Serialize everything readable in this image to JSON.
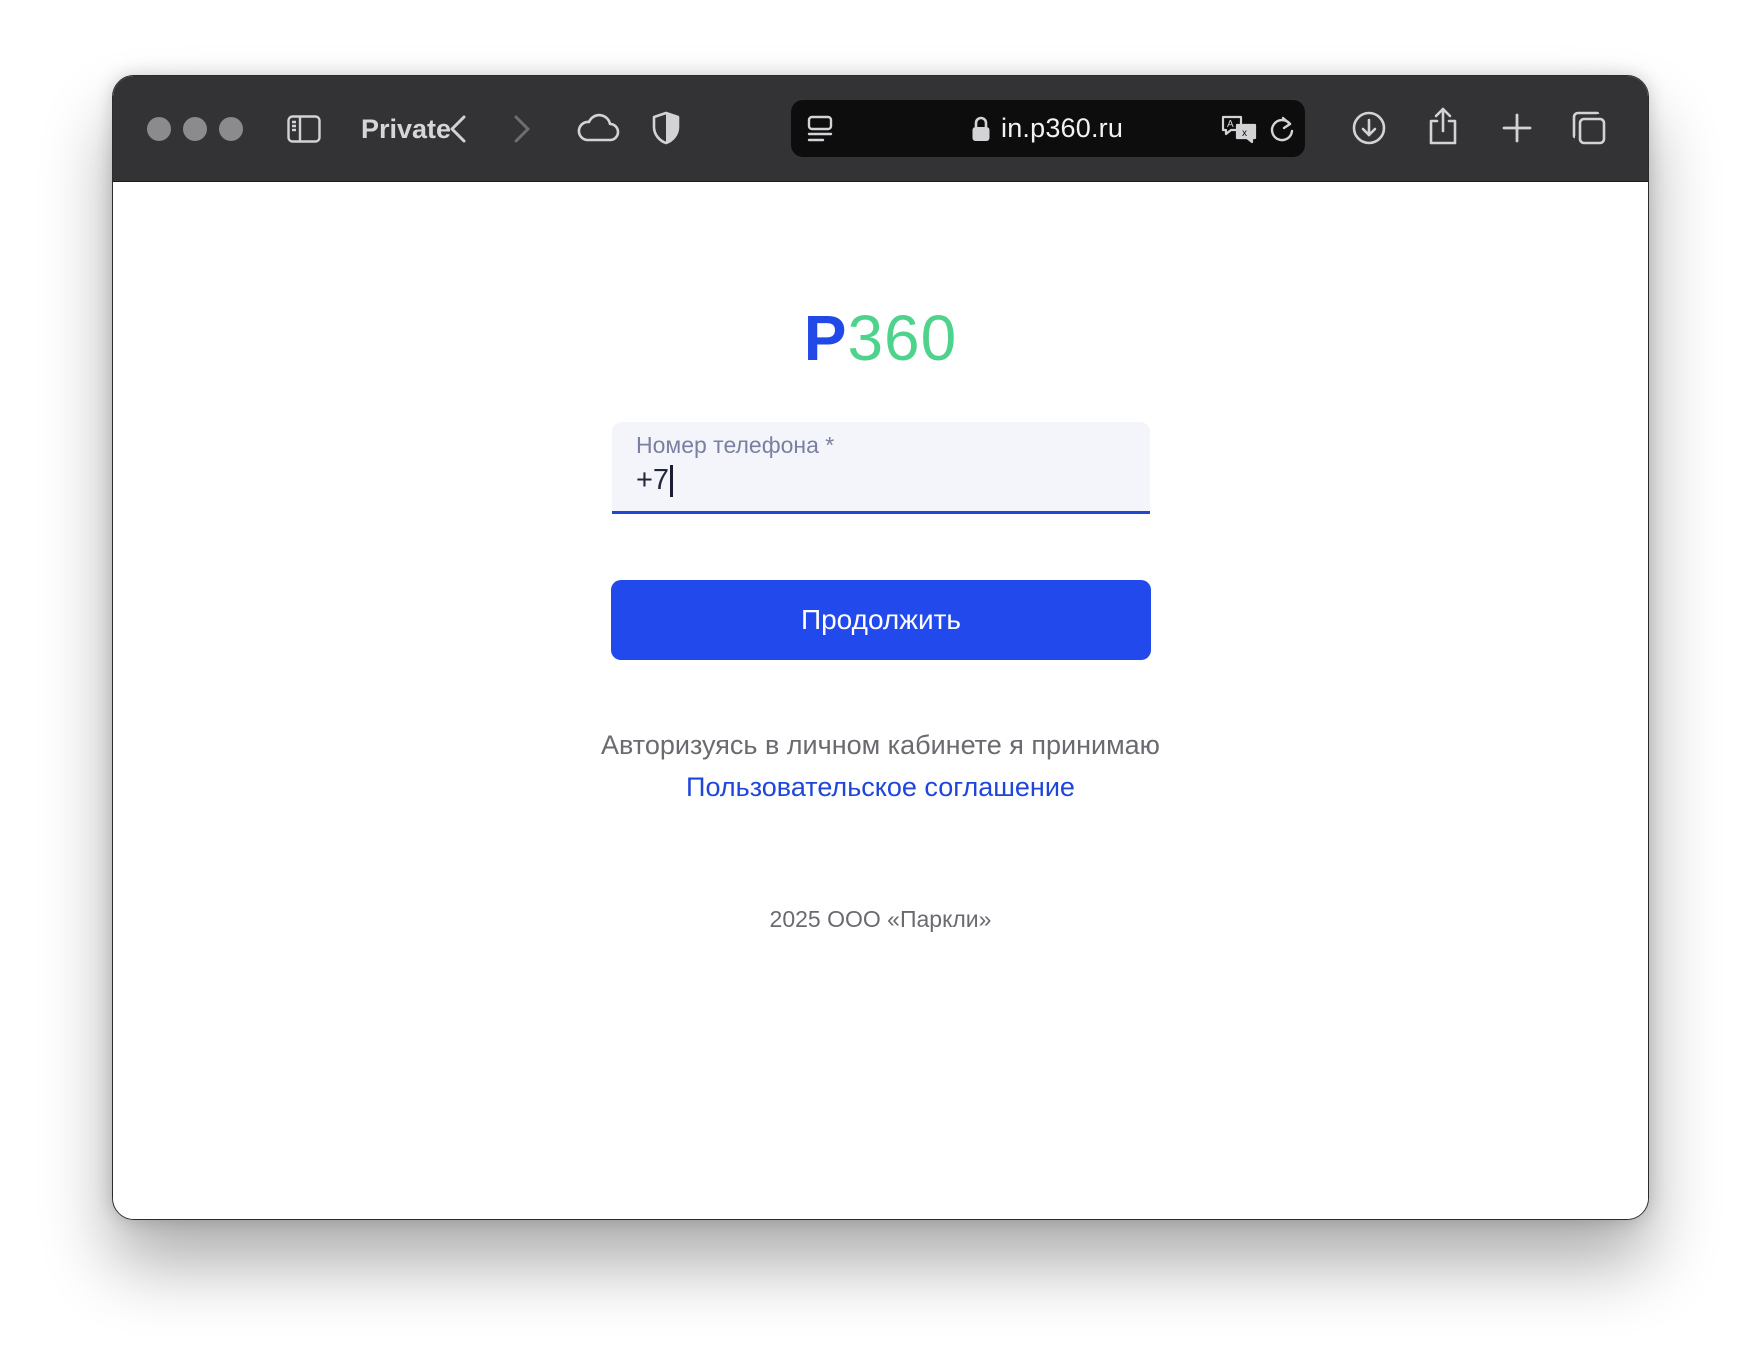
{
  "browser": {
    "mode_label": "Private",
    "url": "in.p360.ru",
    "colors": {
      "toolbar": "#333335",
      "address_bar": "#0d0d0e"
    },
    "icons": [
      "close-light",
      "minimize-light",
      "zoom-light",
      "sidebar-icon",
      "back-arrow-icon",
      "forward-arrow-icon",
      "cloud-icon",
      "shield-icon",
      "reader-icon",
      "lock-icon",
      "translate-icon",
      "reload-icon",
      "download-icon",
      "share-icon",
      "new-tab-icon",
      "tabs-overview-icon"
    ]
  },
  "page": {
    "logo": {
      "letter": "P",
      "number": "360",
      "colors": {
        "letter": "#2149e8",
        "number": "#4ed38d"
      }
    },
    "phone_field": {
      "label": "Номер телефона *",
      "value": "+7"
    },
    "continue_button": {
      "label": "Продолжить",
      "color": "#2149ec"
    },
    "agreement": {
      "text": "Авторизуясь в личном кабинете я принимаю",
      "link": "Пользовательское соглашение"
    },
    "footer": "2025 ООО «Паркли»"
  }
}
